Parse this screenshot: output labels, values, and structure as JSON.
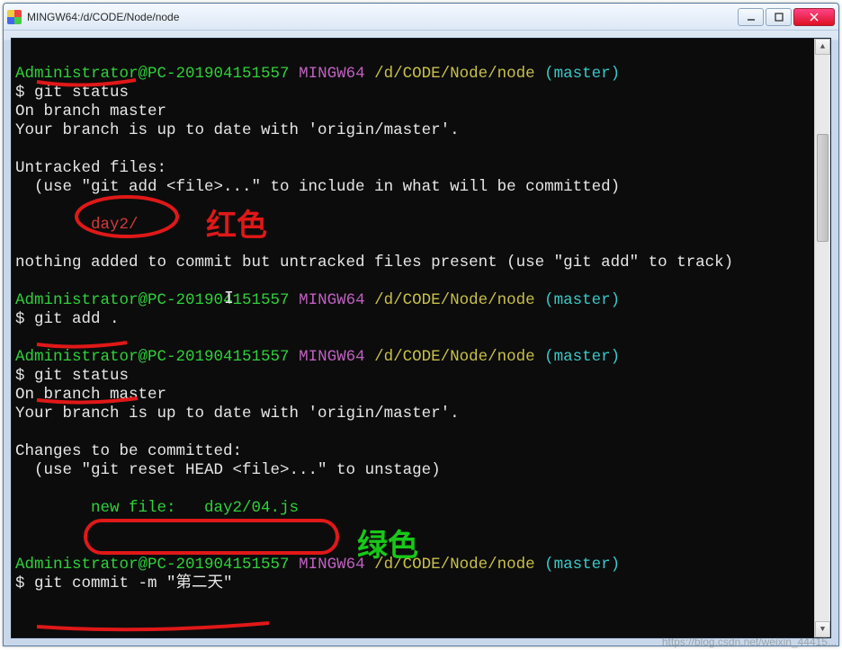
{
  "window": {
    "title": "MINGW64:/d/CODE/Node/node"
  },
  "prompt": {
    "userhost": "Administrator@PC-201904151557",
    "shell": "MINGW64",
    "path": "/d/CODE/Node/node",
    "branch": "(master)",
    "dollar": "$"
  },
  "cmds": {
    "status": "git status",
    "add": "git add .",
    "commit": "git commit -m \"第二天\""
  },
  "out1": {
    "branch": "On branch master",
    "uptodate": "Your branch is up to date with 'origin/master'.",
    "blank": "",
    "untracked_hdr": "Untracked files:",
    "untracked_hint": "  (use \"git add <file>...\" to include in what will be committed)",
    "untracked_item": "        day2/",
    "nothing": "nothing added to commit but untracked files present (use \"git add\" to track)"
  },
  "out2": {
    "branch": "On branch master",
    "uptodate": "Your branch is up to date with 'origin/master'.",
    "blank": "",
    "changes_hdr": "Changes to be committed:",
    "changes_hint": "  (use \"git reset HEAD <file>...\" to unstage)",
    "new_file": "        new file:   day2/04.js"
  },
  "annotations": {
    "red_label": "红色",
    "green_label": "绿色"
  },
  "watermark": "https://blog.csdn.net/weixin_44415...",
  "colors": {
    "term_bg": "#0c0c0c",
    "green": "#2fd13a",
    "purple": "#c060c0",
    "yellow": "#c8c04a",
    "cyan": "#3ac8c8",
    "red_text": "#d23a3a",
    "anno_red": "#e01818",
    "anno_green": "#18c818"
  }
}
